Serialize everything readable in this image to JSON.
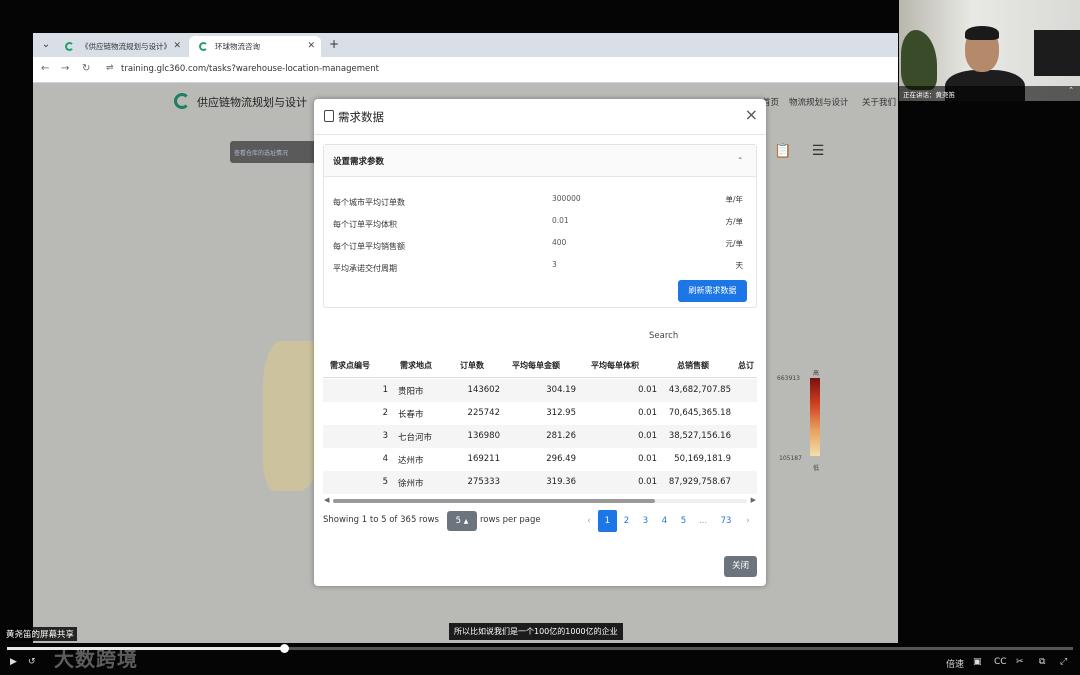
{
  "browser": {
    "tabs": [
      {
        "label": "《供应链物流规划与设计》"
      },
      {
        "label": "环球物流咨询"
      }
    ],
    "url": "training.glc360.com/tasks?warehouse-location-management"
  },
  "site": {
    "title": "供应链物流规划与设计",
    "nav": [
      "首页",
      "物流规划与设计",
      "关于我们"
    ],
    "badge": "查看仓库的选址情况"
  },
  "legend": {
    "max": "663913",
    "min": "105187",
    "high": "高",
    "low": "低"
  },
  "modal": {
    "title": "需求数据",
    "close_icon": "×",
    "section": {
      "title": "设置需求参数",
      "toggle": "-",
      "params": [
        {
          "label": "每个城市平均订单数",
          "value": "300000",
          "unit": "单/年"
        },
        {
          "label": "每个订单平均体积",
          "value": "0.01",
          "unit": "方/单"
        },
        {
          "label": "每个订单平均销售额",
          "value": "400",
          "unit": "元/单"
        },
        {
          "label": "平均承诺交付周期",
          "value": "3",
          "unit": "天"
        }
      ],
      "refresh_label": "刷新需求数据"
    },
    "search_placeholder": "Search",
    "table": {
      "headers": [
        "需求点编号",
        "需求地点",
        "订单数",
        "平均每单金额",
        "平均每单体积",
        "总销售额",
        "总订"
      ],
      "rows": [
        [
          "1",
          "贵阳市",
          "143602",
          "304.19",
          "0.01",
          "43,682,707.85"
        ],
        [
          "2",
          "长春市",
          "225742",
          "312.95",
          "0.01",
          "70,645,365.18"
        ],
        [
          "3",
          "七台河市",
          "136980",
          "281.26",
          "0.01",
          "38,527,156.16"
        ],
        [
          "4",
          "达州市",
          "169211",
          "296.49",
          "0.01",
          "50,169,181.9"
        ],
        [
          "5",
          "徐州市",
          "275333",
          "319.36",
          "0.01",
          "87,929,758.67"
        ]
      ]
    },
    "showing": "Showing 1 to 5 of 365 rows",
    "page_size": "5",
    "rows_per_page": "rows per page",
    "pages": [
      "‹",
      "1",
      "2",
      "3",
      "4",
      "5",
      "...",
      "73",
      "›"
    ],
    "close_label": "关闭"
  },
  "webcam": {
    "label": "正在讲话：黄尧笛"
  },
  "player": {
    "share_label": "黄尧笛的屏幕共享",
    "subtitle": "所以比如说我们是一个100亿的1000亿的企业",
    "watermark": "大数跨境",
    "speed_label": "倍速",
    "progress": 0.26
  }
}
